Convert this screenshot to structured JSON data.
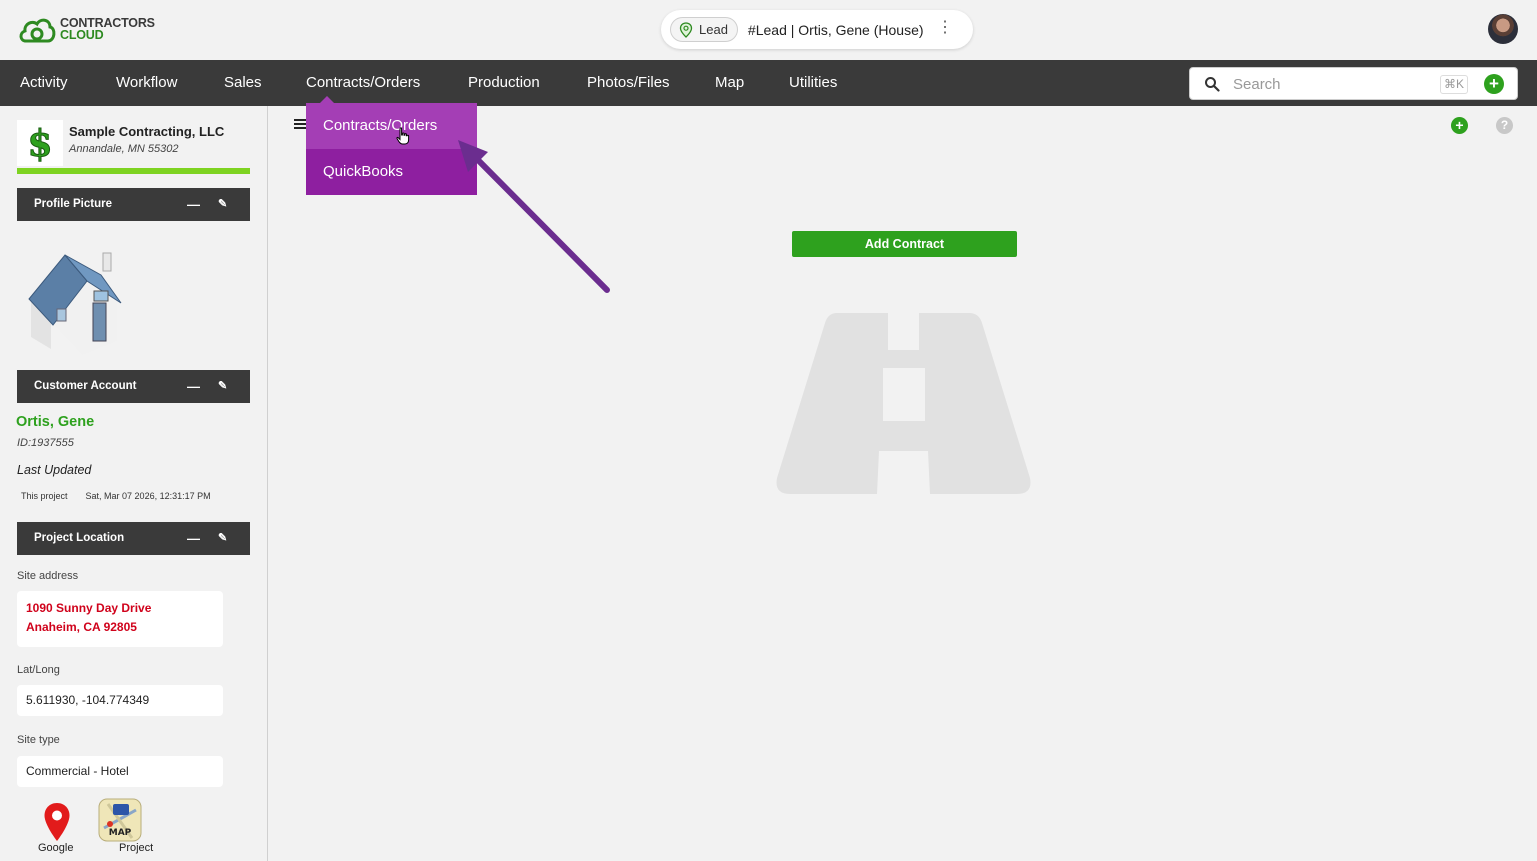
{
  "app": {
    "logo_line1": "CONTRACTORS",
    "logo_line2": "CLOUD",
    "brand_color": "#2e8a21"
  },
  "record": {
    "chip_label": "Lead",
    "title": "#Lead | Ortis, Gene (House)",
    "menu_icon": "kebab-icon"
  },
  "nav": {
    "items": [
      "Activity",
      "Workflow",
      "Sales",
      "Contracts/Orders",
      "Production",
      "Photos/Files",
      "Map",
      "Utilities"
    ],
    "bg_color": "#3a3a3a"
  },
  "search": {
    "placeholder": "Search",
    "shortcut": "⌘K"
  },
  "dropdown": {
    "items": [
      "Contracts/Orders",
      "QuickBooks"
    ],
    "active": "Contracts/Orders",
    "color": "#8e1fa0"
  },
  "sidebar": {
    "company_name": "Sample Contracting, LLC",
    "company_address": "Annandale, MN 55302",
    "profile_panel": "Profile Picture",
    "customer_panel": "Customer Account",
    "customer_name": "Ortis, Gene",
    "customer_id": "ID:1937555",
    "last_updated_label": "Last Updated",
    "this_project_label": "This project",
    "this_project_date": "Sat, Mar 07 2026, 12:31:17 PM",
    "location_panel": "Project Location",
    "site_address_label": "Site address",
    "site_address_line1": "1090 Sunny Day Drive",
    "site_address_line2": "Anaheim, CA 92805",
    "latlong_label": "Lat/Long",
    "latlong_value": "5.611930, -104.774349",
    "site_type_label": "Site type",
    "site_type_value": "Commercial - Hotel",
    "map_google_label": "Google",
    "map_project_label": "Project"
  },
  "main": {
    "add_contract_label": "Add Contract",
    "accent_green": "#2ea11e"
  }
}
